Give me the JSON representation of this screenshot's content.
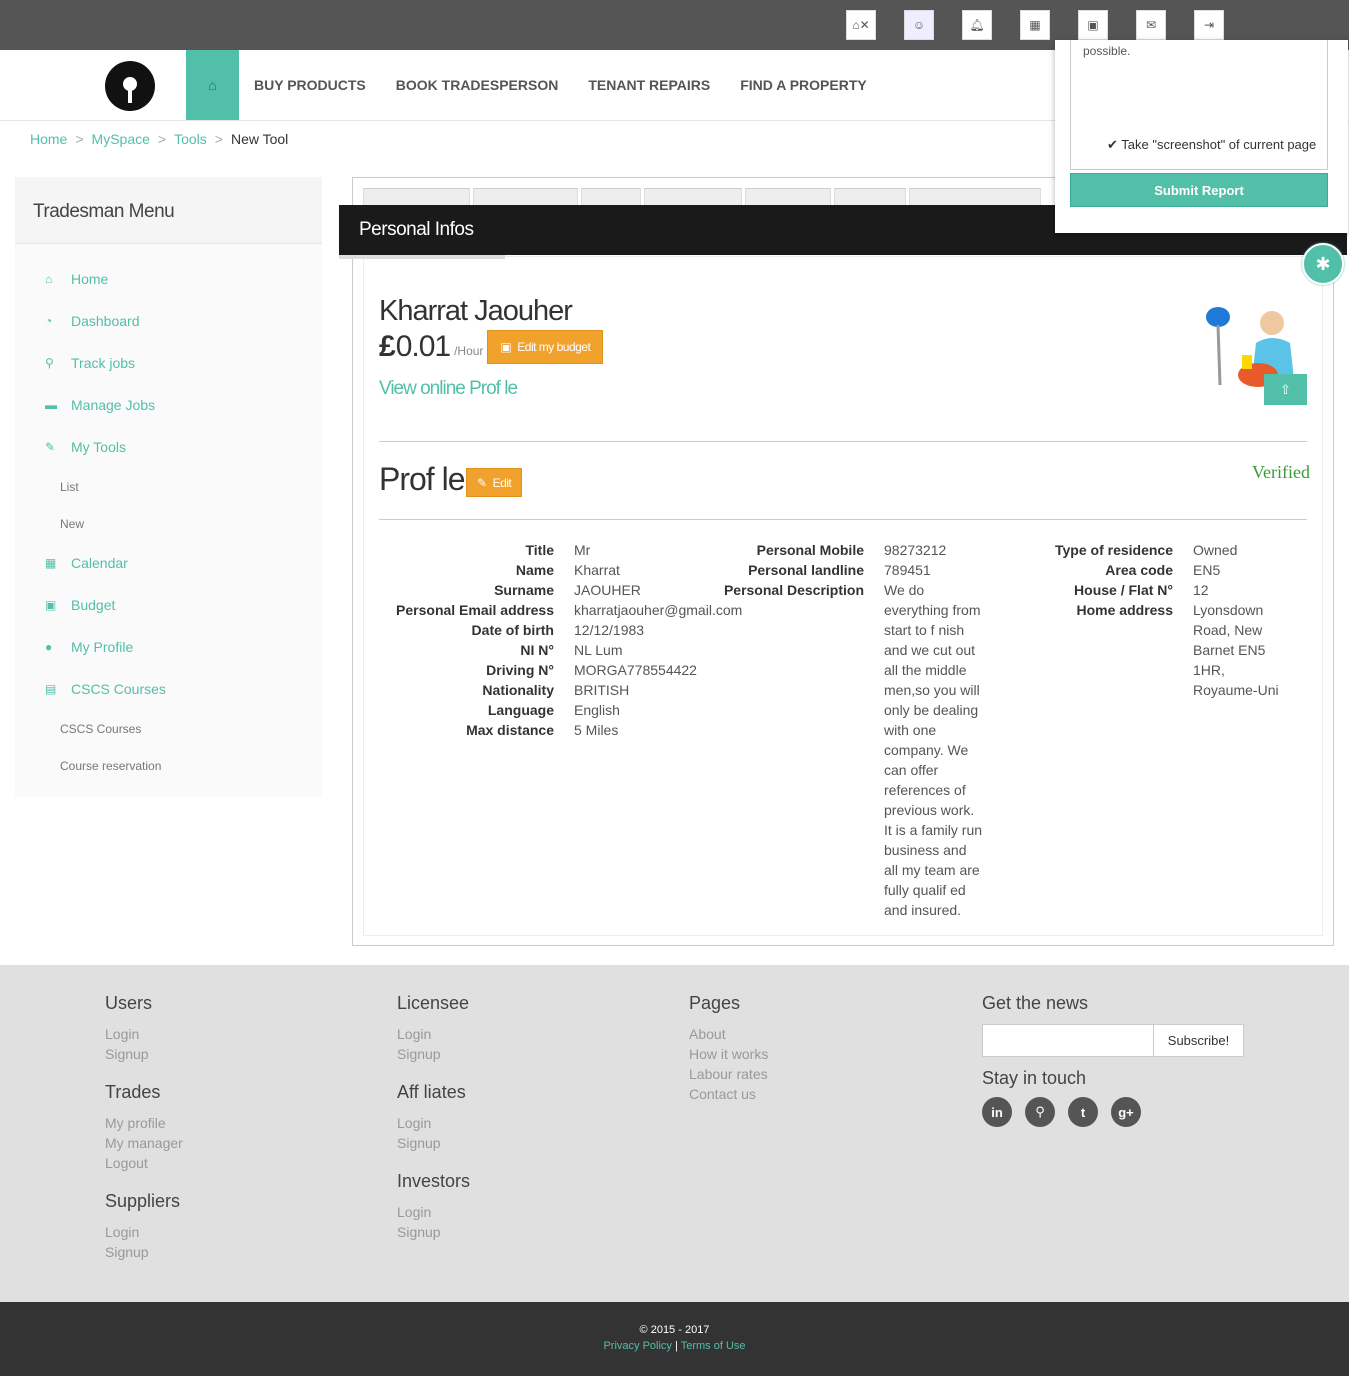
{
  "top_icons": [
    "home-x-icon",
    "avatar",
    "bell-x-icon",
    "calendar-x-icon",
    "money-x-icon",
    "mail-x-icon",
    "signout-x-icon"
  ],
  "nav": {
    "items": [
      "BUY PRODUCTS",
      "BOOK TRADESPERSON",
      "TENANT REPAIRS",
      "FIND A PROPERTY"
    ]
  },
  "breadcrumb": {
    "home": "Home",
    "myspace": "MySpace",
    "tools": "Tools",
    "current": "New Tool",
    "sep": ">"
  },
  "sidebar": {
    "title": "Tradesman Menu",
    "items": [
      {
        "label": "Home",
        "icon": "home-icon"
      },
      {
        "label": "Dashboard",
        "icon": "dashboard-icon"
      },
      {
        "label": "Track jobs",
        "icon": "map-marker-icon"
      },
      {
        "label": "Manage Jobs",
        "icon": "truck-icon"
      },
      {
        "label": "My Tools",
        "icon": "wrench-icon"
      },
      {
        "label": "Calendar",
        "icon": "calendar-icon"
      },
      {
        "label": "Budget",
        "icon": "money-icon"
      },
      {
        "label": "My Profile",
        "icon": "user-icon"
      },
      {
        "label": "CSCS Courses",
        "icon": "book-icon"
      }
    ],
    "tools_sub": [
      "List",
      "New"
    ],
    "cscs_sub": [
      "CSCS Courses",
      "Course reservation"
    ]
  },
  "section_title": "Personal Infos",
  "person": {
    "name": "Kharrat Jaouher",
    "currency": "£",
    "price": "0.01",
    "per_hour": "/Hour",
    "edit_budget": "Edit my budget",
    "view_profile": "View online Prof le"
  },
  "profile": {
    "title": "Prof le",
    "edit": "Edit",
    "verified": "Verified",
    "col1": [
      {
        "label": "Title",
        "value": "Mr"
      },
      {
        "label": "Name",
        "value": "Kharrat"
      },
      {
        "label": "Surname",
        "value": "JAOUHER"
      },
      {
        "label": "Personal Email address",
        "value": "kharratjaouher@gmail.com"
      },
      {
        "label": "Date of birth",
        "value": "12/12/1983"
      },
      {
        "label": "NI N°",
        "value": "NL Lum"
      },
      {
        "label": "Driving N°",
        "value": "MORGA778554422"
      },
      {
        "label": "Nationality",
        "value": "BRITISH"
      },
      {
        "label": "Language",
        "value": "English"
      },
      {
        "label": "Max distance",
        "value": "5 Miles"
      }
    ],
    "col2": [
      {
        "label": "Personal Mobile",
        "value": "98273212"
      },
      {
        "label": "Personal landline",
        "value": "789451"
      },
      {
        "label": "Personal Description",
        "value": "We do everything from start to f nish and we cut out all the middle men,so you will only be dealing with one company. We can offer references of previous work. It is a family run business and all my team are fully qualif ed and insured."
      }
    ],
    "col3": [
      {
        "label": "Type of residence",
        "value": "Owned"
      },
      {
        "label": "Area code",
        "value": "EN5"
      },
      {
        "label": "House / Flat N°",
        "value": "12"
      },
      {
        "label": "Home address",
        "value": "Lyonsdown Road, New Barnet EN5 1HR, Royaume-Uni"
      }
    ]
  },
  "report": {
    "text": "possible.",
    "screenshot": "Take \"screenshot\" of current page",
    "submit": "Submit Report"
  },
  "footer": {
    "users": {
      "title": "Users",
      "links": [
        "Login",
        "Signup"
      ]
    },
    "trades": {
      "title": "Trades",
      "links": [
        "My profile",
        "My manager",
        "Logout"
      ]
    },
    "suppliers": {
      "title": "Suppliers",
      "links": [
        "Login",
        "Signup"
      ]
    },
    "licensee": {
      "title": "Licensee",
      "links": [
        "Login",
        "Signup"
      ]
    },
    "affiliates": {
      "title": "Aff liates",
      "links": [
        "Login",
        "Signup"
      ]
    },
    "investors": {
      "title": "Investors",
      "links": [
        "Login",
        "Signup"
      ]
    },
    "pages": {
      "title": "Pages",
      "links": [
        "About",
        "How it works",
        "Labour rates",
        "Contact us"
      ]
    },
    "news": {
      "title": "Get the news",
      "subscribe": "Subscribe!"
    },
    "touch": {
      "title": "Stay in touch",
      "social": [
        "in",
        "⚲",
        "t",
        "g+"
      ]
    }
  },
  "bottom": {
    "copyright": "© 2015 - 2017",
    "privacy": "Privacy Policy",
    "sep": "|",
    "terms": "Terms of Use"
  }
}
